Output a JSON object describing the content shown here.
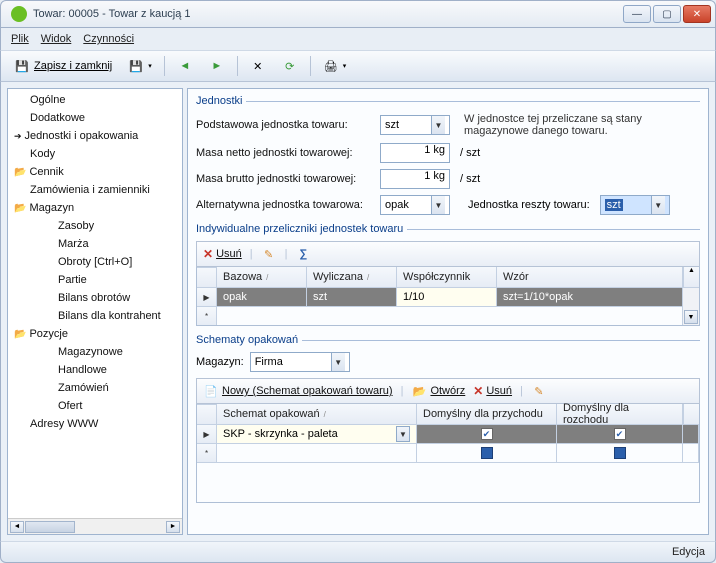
{
  "window": {
    "title": "Towar: 00005 - Towar z kaucją 1"
  },
  "menu": {
    "plik": "Plik",
    "widok": "Widok",
    "czynnosci": "Czynności"
  },
  "toolbar": {
    "save_close": "Zapisz i zamknij"
  },
  "sidebar": {
    "items": [
      {
        "label": "Ogólne",
        "kind": "plain"
      },
      {
        "label": "Dodatkowe",
        "kind": "plain"
      },
      {
        "label": "Jednostki i opakowania",
        "kind": "active"
      },
      {
        "label": "Kody",
        "kind": "plain"
      },
      {
        "label": "Cennik",
        "kind": "folder"
      },
      {
        "label": "Zamówienia i zamienniki",
        "kind": "plain"
      },
      {
        "label": "Magazyn",
        "kind": "folder"
      },
      {
        "label": "Zasoby",
        "kind": "child"
      },
      {
        "label": "Marża",
        "kind": "child"
      },
      {
        "label": "Obroty [Ctrl+O]",
        "kind": "child"
      },
      {
        "label": "Partie",
        "kind": "child"
      },
      {
        "label": "Bilans obrotów",
        "kind": "child"
      },
      {
        "label": "Bilans dla kontrahent",
        "kind": "child"
      },
      {
        "label": "Pozycje",
        "kind": "folder"
      },
      {
        "label": "Magazynowe",
        "kind": "child"
      },
      {
        "label": "Handlowe",
        "kind": "child"
      },
      {
        "label": "Zamówień",
        "kind": "child"
      },
      {
        "label": "Ofert",
        "kind": "child"
      },
      {
        "label": "Adresy WWW",
        "kind": "plain"
      }
    ]
  },
  "unit_section": {
    "title": "Jednostki",
    "base_label": "Podstawowa jednostka towaru:",
    "base_value": "szt",
    "hint": "W jednostce tej przeliczane są stany magazynowe danego towaru.",
    "net_label": "Masa netto jednostki towarowej:",
    "net_value": "1 kg",
    "net_suffix": "/   szt",
    "gross_label": "Masa brutto jednostki towarowej:",
    "gross_value": "1 kg",
    "gross_suffix": "/   szt",
    "alt_label": "Alternatywna jednostka towarowa:",
    "alt_value": "opak",
    "rest_label": "Jednostka reszty towaru:",
    "rest_value": "szt"
  },
  "conv_section": {
    "title": "Indywidualne przeliczniki jednostek towaru",
    "delete": "Usuń",
    "headers": {
      "base": "Bazowa",
      "calc": "Wyliczana",
      "coef": "Współczynnik",
      "pattern": "Wzór"
    },
    "row": {
      "base": "opak",
      "calc": "szt",
      "coef": "1/10",
      "pattern": "szt=1/10*opak"
    }
  },
  "pack_section": {
    "title": "Schematy opakowań",
    "mag_label": "Magazyn:",
    "mag_value": "Firma",
    "new": "Nowy (Schemat opakowań towaru)",
    "open": "Otwórz",
    "delete": "Usuń",
    "headers": {
      "scheme": "Schemat opakowań",
      "def_in": "Domyślny dla przychodu",
      "def_out": "Domyślny dla rozchodu"
    },
    "row": {
      "scheme": "SKP - skrzynka - paleta"
    }
  },
  "status": {
    "text": "Edycja"
  }
}
